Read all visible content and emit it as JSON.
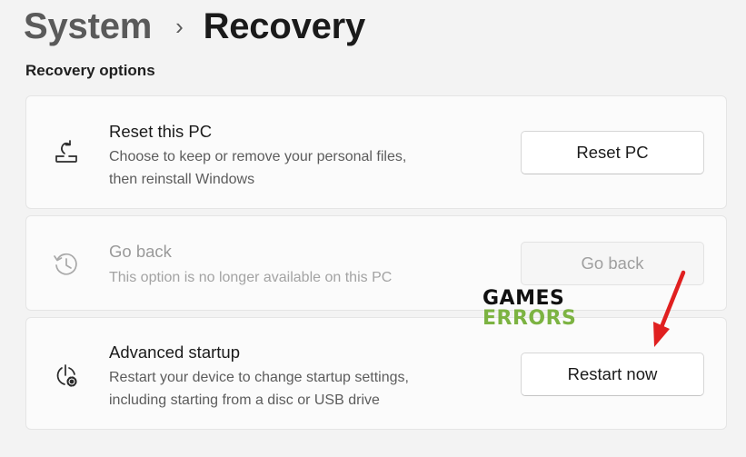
{
  "breadcrumb": {
    "parent": "System",
    "separator": "›",
    "current": "Recovery"
  },
  "section_title": "Recovery options",
  "cards": {
    "reset": {
      "icon": "reset-pc-icon",
      "title": "Reset this PC",
      "desc_line1": "Choose to keep or remove your personal files,",
      "desc_line2": "then reinstall Windows",
      "button_label": "Reset PC"
    },
    "goback": {
      "icon": "history-icon",
      "title": "Go back",
      "desc_line1": "This option is no longer available on this PC",
      "button_label": "Go back",
      "enabled": false
    },
    "advanced": {
      "icon": "advanced-startup-icon",
      "title": "Advanced startup",
      "desc_line1": "Restart your device to change startup settings,",
      "desc_line2": "including starting from a disc or USB drive",
      "button_label": "Restart now"
    }
  },
  "watermark": {
    "line1": "GAMES",
    "line2": "ERRORS",
    "line1_color": "#111111",
    "line2_color": "#7cb342"
  },
  "annotation": {
    "icon": "red-arrow-icon",
    "color": "#e02020"
  }
}
